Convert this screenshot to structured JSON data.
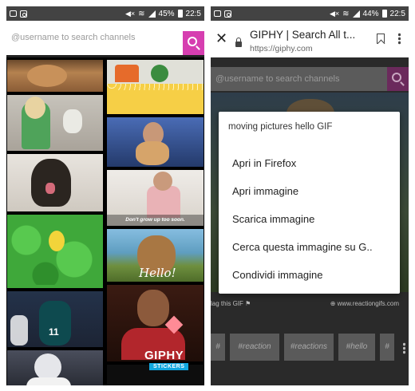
{
  "left_phone": {
    "status": {
      "battery": "45%",
      "time": "22:5"
    },
    "search": {
      "placeholder": "@username to search channels"
    },
    "gif_captions": {
      "guy": "Don't grow up too soon.",
      "bear": "Hello!"
    },
    "football_number": "11",
    "giphy_badge": {
      "title": "GIPHY",
      "subtitle": "STICKERS"
    }
  },
  "right_phone": {
    "status": {
      "battery": "44%",
      "time": "22:5"
    },
    "browser": {
      "title": "GIPHY | Search All t...",
      "url": "https://giphy.com"
    },
    "search": {
      "placeholder": "@username to search channels"
    },
    "flag_text": "lag this GIF",
    "source_text": "www.reactiongifs.com",
    "tags": [
      "#",
      "#reaction",
      "#reactions",
      "#hello",
      "#"
    ],
    "context_menu": {
      "title": "moving pictures hello GIF",
      "items": [
        "Apri in Firefox",
        "Apri immagine",
        "Scarica immagine",
        "Cerca questa immagine su G..",
        "Condividi immagine"
      ]
    }
  },
  "colors": {
    "accent": "#d63eb0",
    "statusbar": "#434343"
  },
  "icons": [
    "instagram-icon",
    "mute-icon",
    "wifi-icon",
    "signal-icon",
    "battery-icon",
    "search-icon",
    "close-icon",
    "lock-icon",
    "bookmark-icon",
    "more-vert-icon",
    "flag-icon",
    "globe-icon"
  ]
}
